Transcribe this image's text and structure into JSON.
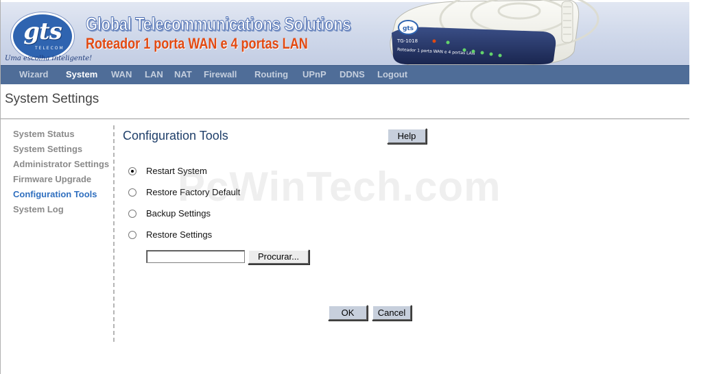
{
  "banner": {
    "logo_text": "gts",
    "logo_subtext": "TELECOM",
    "tagline": "Uma escolha inteligente!",
    "company_title": "Global Telecommunications Solutions",
    "product_title": "Roteador 1 porta WAN e 4 portas LAN",
    "device_model": "TG-1018",
    "device_desc": "Roteador 1 porta WAN e 4 portas LAN"
  },
  "nav": {
    "items": [
      "Wizard",
      "System",
      "WAN",
      "LAN",
      "NAT",
      "Firewall",
      "Routing",
      "UPnP",
      "DDNS",
      "Logout"
    ],
    "active": "System"
  },
  "page": {
    "title": "System Settings"
  },
  "sidebar": {
    "items": [
      "System Status",
      "System Settings",
      "Administrator Settings",
      "Firmware Upgrade",
      "Configuration Tools",
      "System Log"
    ],
    "active": "Configuration Tools"
  },
  "main": {
    "section_title": "Configuration Tools",
    "help_label": "Help",
    "options": [
      {
        "label": "Restart System",
        "selected": true
      },
      {
        "label": "Restore Factory Default",
        "selected": false
      },
      {
        "label": "Backup Settings",
        "selected": false
      },
      {
        "label": "Restore Settings",
        "selected": false
      }
    ],
    "file_input_value": "",
    "browse_label": "Procurar...",
    "ok_label": "OK",
    "cancel_label": "Cancel"
  },
  "watermark": "PcWinTech.com",
  "colors": {
    "nav_bg": "#4f6d98",
    "nav_active": "#ffffff",
    "nav_inactive": "#c5cfde",
    "sidebar_active": "#2f6fbf",
    "sidebar_inactive": "#8a8a8a",
    "button_bg": "#c7cfdc",
    "product_title": "#e24a12"
  }
}
